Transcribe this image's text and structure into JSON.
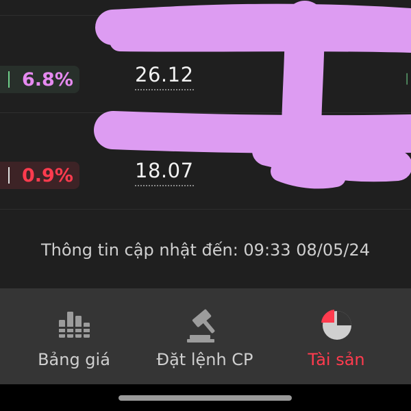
{
  "rows": [
    {
      "change": "",
      "direction": "",
      "price": ""
    },
    {
      "change": "6.8%",
      "direction": "up",
      "price": "26.12"
    },
    {
      "change": "0.9%",
      "direction": "down",
      "price": "18.07"
    }
  ],
  "update_info": "Thông tin cập nhật đến: 09:33 08/05/24",
  "bottom_nav": {
    "items": [
      {
        "label": "Bảng giá",
        "icon": "bar-chart-icon",
        "active": false
      },
      {
        "label": "Đặt lệnh CP",
        "icon": "gavel-icon",
        "active": false
      },
      {
        "label": "Tài sản",
        "icon": "pie-chart-icon",
        "active": true
      }
    ]
  },
  "colors": {
    "background": "#1f1f1f",
    "nav_background": "#353535",
    "up_text": "#e58af0",
    "up_badge": "#28302b",
    "down_text": "#ff3b4e",
    "down_badge": "#3d2326",
    "active_accent": "#ff3b4e",
    "scribble": "#dd9cf2"
  }
}
